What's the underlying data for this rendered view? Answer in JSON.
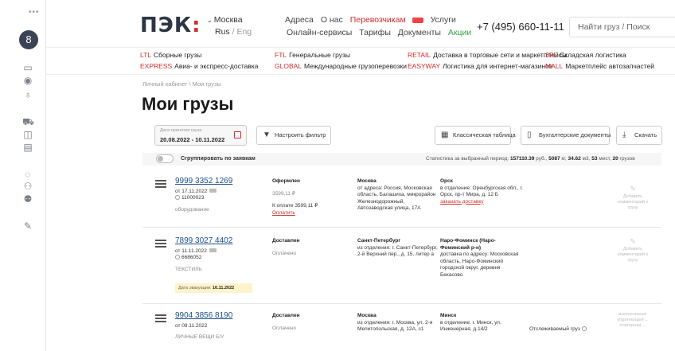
{
  "rail": {
    "dots": "•••",
    "avatar_letter": "8"
  },
  "header": {
    "logo": "ПЭК",
    "logo_colon": ":",
    "city": "Москва",
    "lang_ru": "Rus",
    "lang_sep": " / ",
    "lang_en": "Eng",
    "nav_top": [
      "Адреса",
      "О нас",
      "Перевозчикам",
      "Услуги"
    ],
    "nav_bottom": [
      "Онлайн-сервисы",
      "Тарифы",
      "Документы",
      "Акции"
    ],
    "phone": "+7 (495) 660-11-11",
    "search_placeholder": "Найти груз / Поиск"
  },
  "services": [
    {
      "code": "LTL",
      "label": "Сборные грузы"
    },
    {
      "code": "FTL",
      "label": "Генеральные грузы"
    },
    {
      "code": "RETAIL",
      "label": "Доставка в торговые сети и маркетплейсы"
    },
    {
      "code": "3PL",
      "label": "Складская логистика"
    },
    {
      "code": "EXPRESS",
      "label": "Авиа- и экспресс-доставка"
    },
    {
      "code": "GLOBAL",
      "label": "Международные грузоперевозки"
    },
    {
      "code": "EASYWAY",
      "label": "Логистика для интернет-магазинов"
    },
    {
      "code": "MALL",
      "label": "Маркетплейс автозапчастей"
    }
  ],
  "breadcrumb": "Личный кабинет  \\  Мои грузы",
  "page_title": "Мои грузы",
  "filters": {
    "date_label": "Дата принятия груза",
    "date_value": "20.08.2022 - 10.11.2022",
    "filter_btn": "Настроить фильтр",
    "classic_table_btn": "Классическая таблица",
    "accounting_btn": "Бухгалтерские документы",
    "download_btn": "Скачать"
  },
  "group": {
    "label": "Сгруппировать по заявкам",
    "stats_prefix": "Статистика за выбранный период: ",
    "sum": "157110.39",
    "sum_unit": " руб., ",
    "weight": "5087",
    "weight_unit": " кг, ",
    "volume": "34.62",
    "volume_unit": " м3, ",
    "places": "53",
    "places_unit": " мест, ",
    "count": "20",
    "count_unit": " грузов"
  },
  "shipments": [
    {
      "number": "9999 3352 1269",
      "date": "от 17.11.2022",
      "code": "11000023",
      "cargo": "оборудование",
      "status": "Оформлен",
      "amount": "3599,11 ₽",
      "to_pay": "К оплате 3599,11 ₽",
      "pay_link": "Оплатить",
      "from_city": "Москва",
      "from_addr": "от адреса: Россия, Московская область, Балашиха, микрорайон Железнодорожный, Автозаводская улица, 17А",
      "to_city": "Орск",
      "to_addr": "в отделение: Оренбургская обл., г. Орск, пр-т Мира, д. 12 Б",
      "to_link": "заказать доставку",
      "comment": "Добавить комментарий к грузу"
    },
    {
      "number": "7899 3027 4402",
      "date": "от 11.11.2022",
      "code": "6686052",
      "cargo": "ТЕКСТИЛЬ",
      "status": "Доставлен",
      "amount": "Оплачено",
      "from_city": "Санкт-Петербург",
      "from_addr": "из отделения: г. Санкт-Петербург, 2-й Верхний пер., д. 15, литер а",
      "to_city": "Наро-Фоминск (Наро-Фоминский р-н)",
      "to_addr": "доставка по адресу: Московская область, Наро-Фоминский городской округ, деревня Бекасово",
      "evac_label": "Дата эвакуации: ",
      "evac_date": "16.11.2022",
      "comment": "Добавить комментарий к грузу"
    },
    {
      "number": "9904 3856 8190",
      "date": "от 09.11.2022",
      "cargo": "ЛИЧНЫЕ ВЕЩИ Б/У",
      "status": "Доставлен",
      "amount": "Оплачено",
      "from_city": "Москва",
      "from_addr": "из отделения: г. Москва, ул. 2-я Мелитопольская, д. 12А, с1",
      "to_city": "Минск",
      "to_addr": "в отделение: г. Минск, ул. Инженерная, д.14/2",
      "tracked": "Отслеживаемый груз",
      "comment": "выполненные упдатекущей ... платорнаи ..."
    }
  ]
}
